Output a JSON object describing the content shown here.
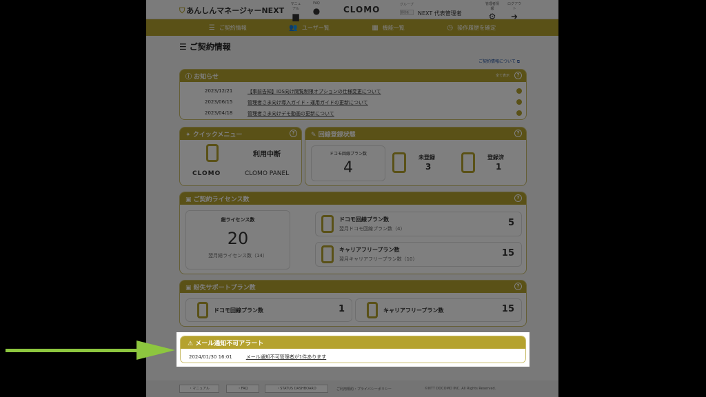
{
  "header": {
    "logo": "あんしんマネージャーNEXT",
    "manual_label": "マニュアル",
    "faq_label": "FAQ",
    "clomo": "CLOMO",
    "group_label": "グループ",
    "group_box": "管理者",
    "admin_name": "NEXT 代表管理者",
    "settings_label": "管理者情報",
    "logout_label": "ログアウト"
  },
  "nav": [
    {
      "label": "ご契約情報",
      "icon": "list-icon"
    },
    {
      "label": "ユーザー覧",
      "icon": "users-icon"
    },
    {
      "label": "機能一覧",
      "icon": "grid-icon"
    },
    {
      "label": "操作履歴を確定",
      "icon": "clock-icon"
    }
  ],
  "page_title": "ご契約情報",
  "about_link": "ご契約情報について",
  "news": {
    "title": "お知らせ",
    "show_all": "全て表示",
    "items": [
      {
        "date": "2023/12/21",
        "text": "【事前告知】iOS向け閲覧制限オプションの仕様変更について"
      },
      {
        "date": "2023/06/15",
        "text": "管理者さま向け導入ガイド・運用ガイドの更新について"
      },
      {
        "date": "2023/04/18",
        "text": "管理者さま向けデモ動画の更新について"
      }
    ]
  },
  "quick_menu": {
    "title": "クイックメニュー",
    "item1": "利用中断",
    "item2_logo": "CLOMO",
    "item2": "CLOMO PANEL"
  },
  "line_status": {
    "title": "回線登録状態",
    "docomo_label": "ドコモ回線プラン数",
    "docomo_value": "4",
    "unregistered_label": "未登録",
    "unregistered_value": "3",
    "registered_label": "登録済",
    "registered_value": "1"
  },
  "license": {
    "title": "ご契約ライセンス数",
    "total_label": "総ライセンス数",
    "total_value": "20",
    "total_next": "翌月総ライセンス数（14）",
    "docomo_label": "ドコモ回線プラン数",
    "docomo_next": "翌月ドコモ回線プラン数（4）",
    "docomo_value": "5",
    "carrier_label": "キャリアフリープラン数",
    "carrier_next": "翌月キャリアフリープラン数（10）",
    "carrier_value": "15"
  },
  "support": {
    "title": "紛失サポートプラン数",
    "docomo_label": "ドコモ回線プラン数",
    "docomo_value": "1",
    "carrier_label": "キャリアフリープラン数",
    "carrier_value": "15"
  },
  "alert": {
    "title": "メール通知不可アラート",
    "date": "2024/01/30 16:01",
    "text": "メール通知不可管理者が1件あります"
  },
  "footer": {
    "manual": "・マニュアル",
    "faq": "・FAQ",
    "status": "・STATUS DASHBOARD",
    "terms": "ご利用規約・プライバシーポリシー",
    "copyright": "©NTT DOCOMO INC. All Rights Reserved."
  },
  "colors": {
    "accent": "#b5a22e",
    "arrow": "#8dc63f"
  }
}
